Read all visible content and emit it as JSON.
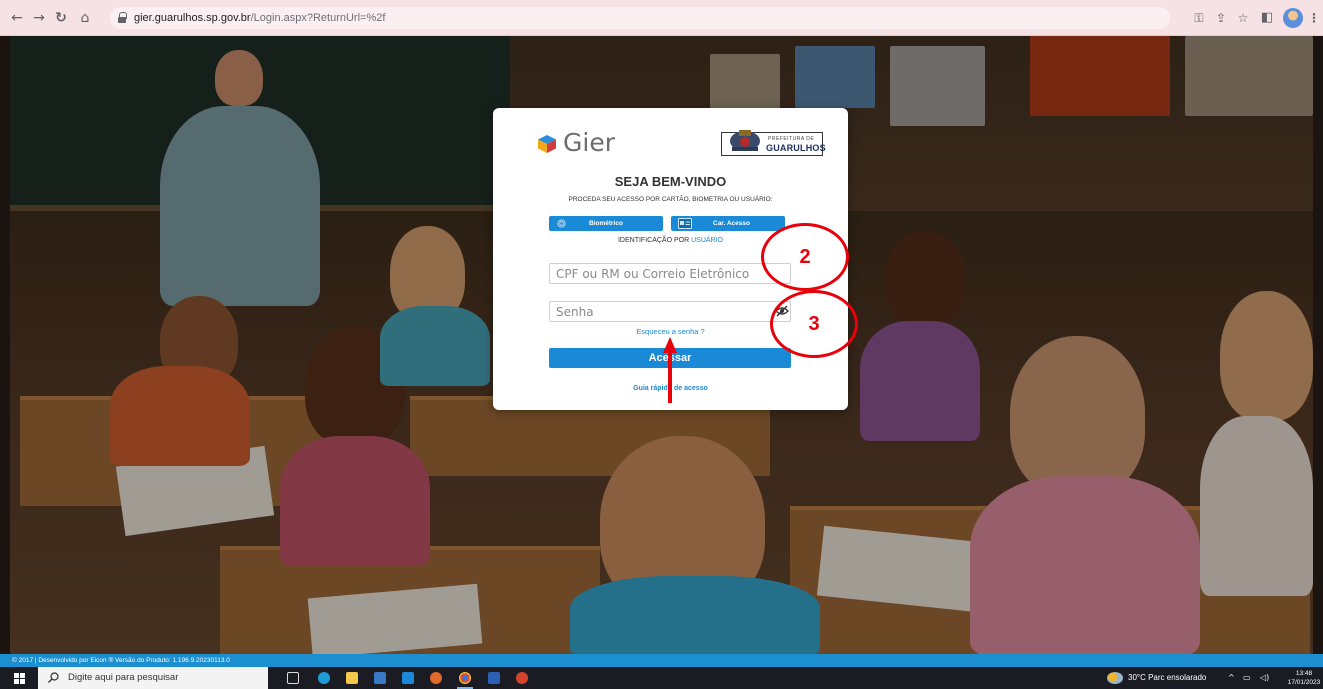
{
  "browser": {
    "url_domain": "gier.guarulhos.sp.gov.br",
    "url_path": "/Login.aspx?ReturnUrl=%2f",
    "icons": [
      "back-icon",
      "forward-icon",
      "reload-icon",
      "home-icon",
      "lock-icon",
      "key-icon",
      "share-icon",
      "star-icon",
      "sidebar-icon",
      "profile-icon",
      "menu-icon"
    ]
  },
  "login": {
    "logo_text": "Gier",
    "seal_small": "PREFEITURA DE",
    "seal_text": "GUARULHOS",
    "welcome": "SEJA BEM-VINDO",
    "subtitle": "PROCEDA SEU ACESSO POR CARTÃO, BIOMETRIA OU USUÁRIO:",
    "biometric_label": "Biométrico",
    "card_label": "Car. Acesso",
    "identification_prefix": "IDENTIFICAÇÃO POR",
    "identification_link": "USUÁRIO",
    "user_placeholder": "CPF ou RM ou Correio Eletrônico",
    "password_placeholder": "Senha",
    "forgot_label": "Esqueceu a senha ?",
    "login_button": "Acessar",
    "guide_link": "Guia rápido de acesso",
    "colors": {
      "accent": "#1a8ad6",
      "card_bg": "#ffffff"
    }
  },
  "annotations": {
    "circle_2": "2",
    "circle_3": "3",
    "color": "#e8000a"
  },
  "footer": {
    "text": "© 2017 | Desenvolvido por Eicon ® Versão do Produto: 1.196.9.20230113.0",
    "color": "#1b8fcf"
  },
  "taskbar": {
    "search_placeholder": "Digite aqui para pesquisar",
    "weather": "30°C  Parc ensolarado",
    "time": "13:48",
    "date": "17/01/2023"
  }
}
